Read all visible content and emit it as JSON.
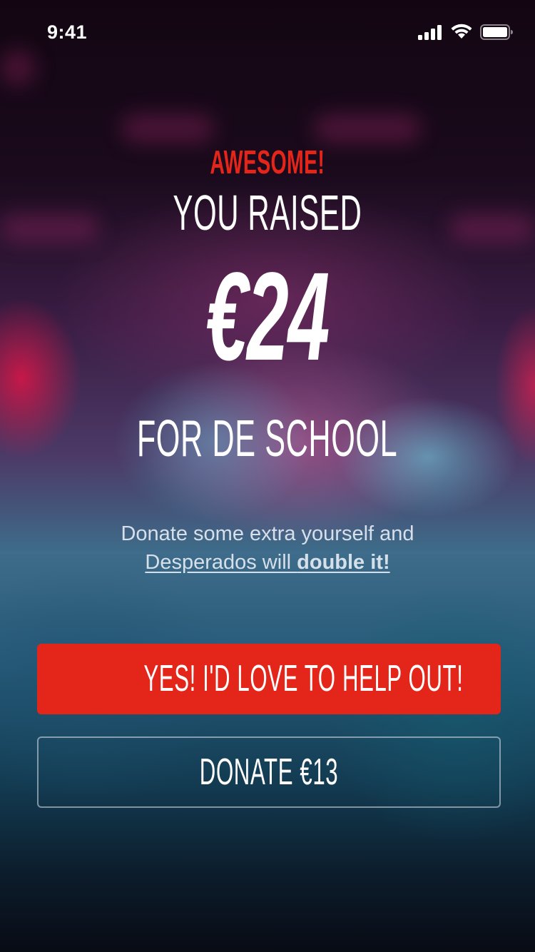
{
  "status_bar": {
    "time": "9:41",
    "signal_icon": "cellular-signal-icon",
    "wifi_icon": "wifi-icon",
    "battery_icon": "battery-icon"
  },
  "result": {
    "headline": "AWESOME!",
    "subheadline": "YOU RAISED",
    "amount": "€24",
    "cause": "FOR DE SCHOOL"
  },
  "prompt": {
    "line1": "Donate some extra yourself and",
    "link_prefix": "Desperados will ",
    "link_bold": "double it!"
  },
  "actions": {
    "primary_label": "YES! I'D LOVE TO HELP OUT!",
    "secondary_label": "DONATE €13"
  },
  "colors": {
    "accent": "#e3251a",
    "text": "#ffffff"
  }
}
